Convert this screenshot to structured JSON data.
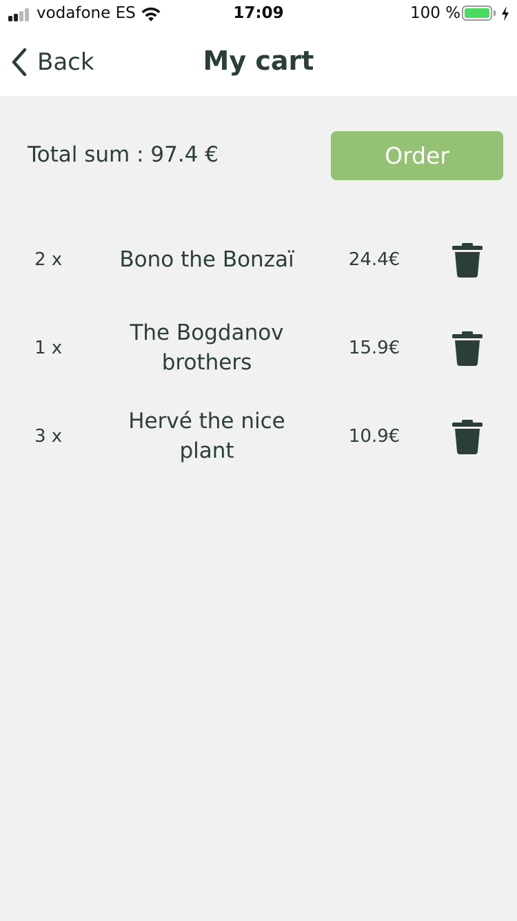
{
  "status_bar": {
    "carrier": "vodafone ES",
    "time": "17:09",
    "battery_percent": "100 %",
    "battery_color": "#4cd964",
    "icons": [
      "signal-icon",
      "wifi-icon",
      "battery-icon",
      "charging-icon"
    ]
  },
  "nav": {
    "back_label": "Back",
    "back_icon": "chevron-left-icon",
    "title": "My cart"
  },
  "summary": {
    "total_label": "Total sum : 97.4 €",
    "order_label": "Order",
    "order_color": "#95c174"
  },
  "cart": {
    "items": [
      {
        "qty": "2 x",
        "name": "Bono the Bonzaï",
        "price": "24.4€",
        "icon": "trash-icon"
      },
      {
        "qty": "1 x",
        "name": "The Bogdanov brothers",
        "price": "15.9€",
        "icon": "trash-icon"
      },
      {
        "qty": "3 x",
        "name": "Hervé the nice plant",
        "price": "10.9€",
        "icon": "trash-icon"
      }
    ]
  },
  "colors": {
    "text": "#2b3f38",
    "background": "#f1f1f1"
  }
}
